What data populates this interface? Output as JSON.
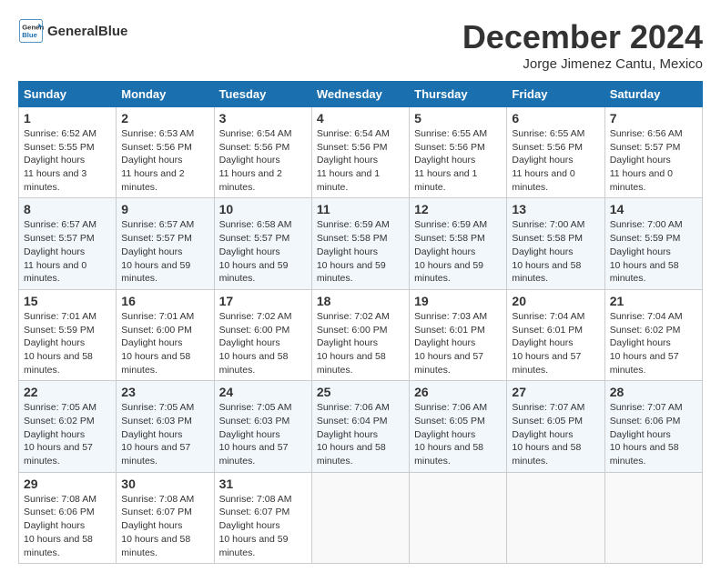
{
  "header": {
    "logo_line1": "General",
    "logo_line2": "Blue",
    "title": "December 2024",
    "subtitle": "Jorge Jimenez Cantu, Mexico"
  },
  "days_of_week": [
    "Sunday",
    "Monday",
    "Tuesday",
    "Wednesday",
    "Thursday",
    "Friday",
    "Saturday"
  ],
  "weeks": [
    [
      {
        "day": "1",
        "sunrise": "6:52 AM",
        "sunset": "5:55 PM",
        "daylight": "11 hours and 3 minutes."
      },
      {
        "day": "2",
        "sunrise": "6:53 AM",
        "sunset": "5:56 PM",
        "daylight": "11 hours and 2 minutes."
      },
      {
        "day": "3",
        "sunrise": "6:54 AM",
        "sunset": "5:56 PM",
        "daylight": "11 hours and 2 minutes."
      },
      {
        "day": "4",
        "sunrise": "6:54 AM",
        "sunset": "5:56 PM",
        "daylight": "11 hours and 1 minute."
      },
      {
        "day": "5",
        "sunrise": "6:55 AM",
        "sunset": "5:56 PM",
        "daylight": "11 hours and 1 minute."
      },
      {
        "day": "6",
        "sunrise": "6:55 AM",
        "sunset": "5:56 PM",
        "daylight": "11 hours and 0 minutes."
      },
      {
        "day": "7",
        "sunrise": "6:56 AM",
        "sunset": "5:57 PM",
        "daylight": "11 hours and 0 minutes."
      }
    ],
    [
      {
        "day": "8",
        "sunrise": "6:57 AM",
        "sunset": "5:57 PM",
        "daylight": "11 hours and 0 minutes."
      },
      {
        "day": "9",
        "sunrise": "6:57 AM",
        "sunset": "5:57 PM",
        "daylight": "10 hours and 59 minutes."
      },
      {
        "day": "10",
        "sunrise": "6:58 AM",
        "sunset": "5:57 PM",
        "daylight": "10 hours and 59 minutes."
      },
      {
        "day": "11",
        "sunrise": "6:59 AM",
        "sunset": "5:58 PM",
        "daylight": "10 hours and 59 minutes."
      },
      {
        "day": "12",
        "sunrise": "6:59 AM",
        "sunset": "5:58 PM",
        "daylight": "10 hours and 59 minutes."
      },
      {
        "day": "13",
        "sunrise": "7:00 AM",
        "sunset": "5:58 PM",
        "daylight": "10 hours and 58 minutes."
      },
      {
        "day": "14",
        "sunrise": "7:00 AM",
        "sunset": "5:59 PM",
        "daylight": "10 hours and 58 minutes."
      }
    ],
    [
      {
        "day": "15",
        "sunrise": "7:01 AM",
        "sunset": "5:59 PM",
        "daylight": "10 hours and 58 minutes."
      },
      {
        "day": "16",
        "sunrise": "7:01 AM",
        "sunset": "6:00 PM",
        "daylight": "10 hours and 58 minutes."
      },
      {
        "day": "17",
        "sunrise": "7:02 AM",
        "sunset": "6:00 PM",
        "daylight": "10 hours and 58 minutes."
      },
      {
        "day": "18",
        "sunrise": "7:02 AM",
        "sunset": "6:00 PM",
        "daylight": "10 hours and 58 minutes."
      },
      {
        "day": "19",
        "sunrise": "7:03 AM",
        "sunset": "6:01 PM",
        "daylight": "10 hours and 57 minutes."
      },
      {
        "day": "20",
        "sunrise": "7:04 AM",
        "sunset": "6:01 PM",
        "daylight": "10 hours and 57 minutes."
      },
      {
        "day": "21",
        "sunrise": "7:04 AM",
        "sunset": "6:02 PM",
        "daylight": "10 hours and 57 minutes."
      }
    ],
    [
      {
        "day": "22",
        "sunrise": "7:05 AM",
        "sunset": "6:02 PM",
        "daylight": "10 hours and 57 minutes."
      },
      {
        "day": "23",
        "sunrise": "7:05 AM",
        "sunset": "6:03 PM",
        "daylight": "10 hours and 57 minutes."
      },
      {
        "day": "24",
        "sunrise": "7:05 AM",
        "sunset": "6:03 PM",
        "daylight": "10 hours and 57 minutes."
      },
      {
        "day": "25",
        "sunrise": "7:06 AM",
        "sunset": "6:04 PM",
        "daylight": "10 hours and 58 minutes."
      },
      {
        "day": "26",
        "sunrise": "7:06 AM",
        "sunset": "6:05 PM",
        "daylight": "10 hours and 58 minutes."
      },
      {
        "day": "27",
        "sunrise": "7:07 AM",
        "sunset": "6:05 PM",
        "daylight": "10 hours and 58 minutes."
      },
      {
        "day": "28",
        "sunrise": "7:07 AM",
        "sunset": "6:06 PM",
        "daylight": "10 hours and 58 minutes."
      }
    ],
    [
      {
        "day": "29",
        "sunrise": "7:08 AM",
        "sunset": "6:06 PM",
        "daylight": "10 hours and 58 minutes."
      },
      {
        "day": "30",
        "sunrise": "7:08 AM",
        "sunset": "6:07 PM",
        "daylight": "10 hours and 58 minutes."
      },
      {
        "day": "31",
        "sunrise": "7:08 AM",
        "sunset": "6:07 PM",
        "daylight": "10 hours and 59 minutes."
      },
      null,
      null,
      null,
      null
    ]
  ]
}
